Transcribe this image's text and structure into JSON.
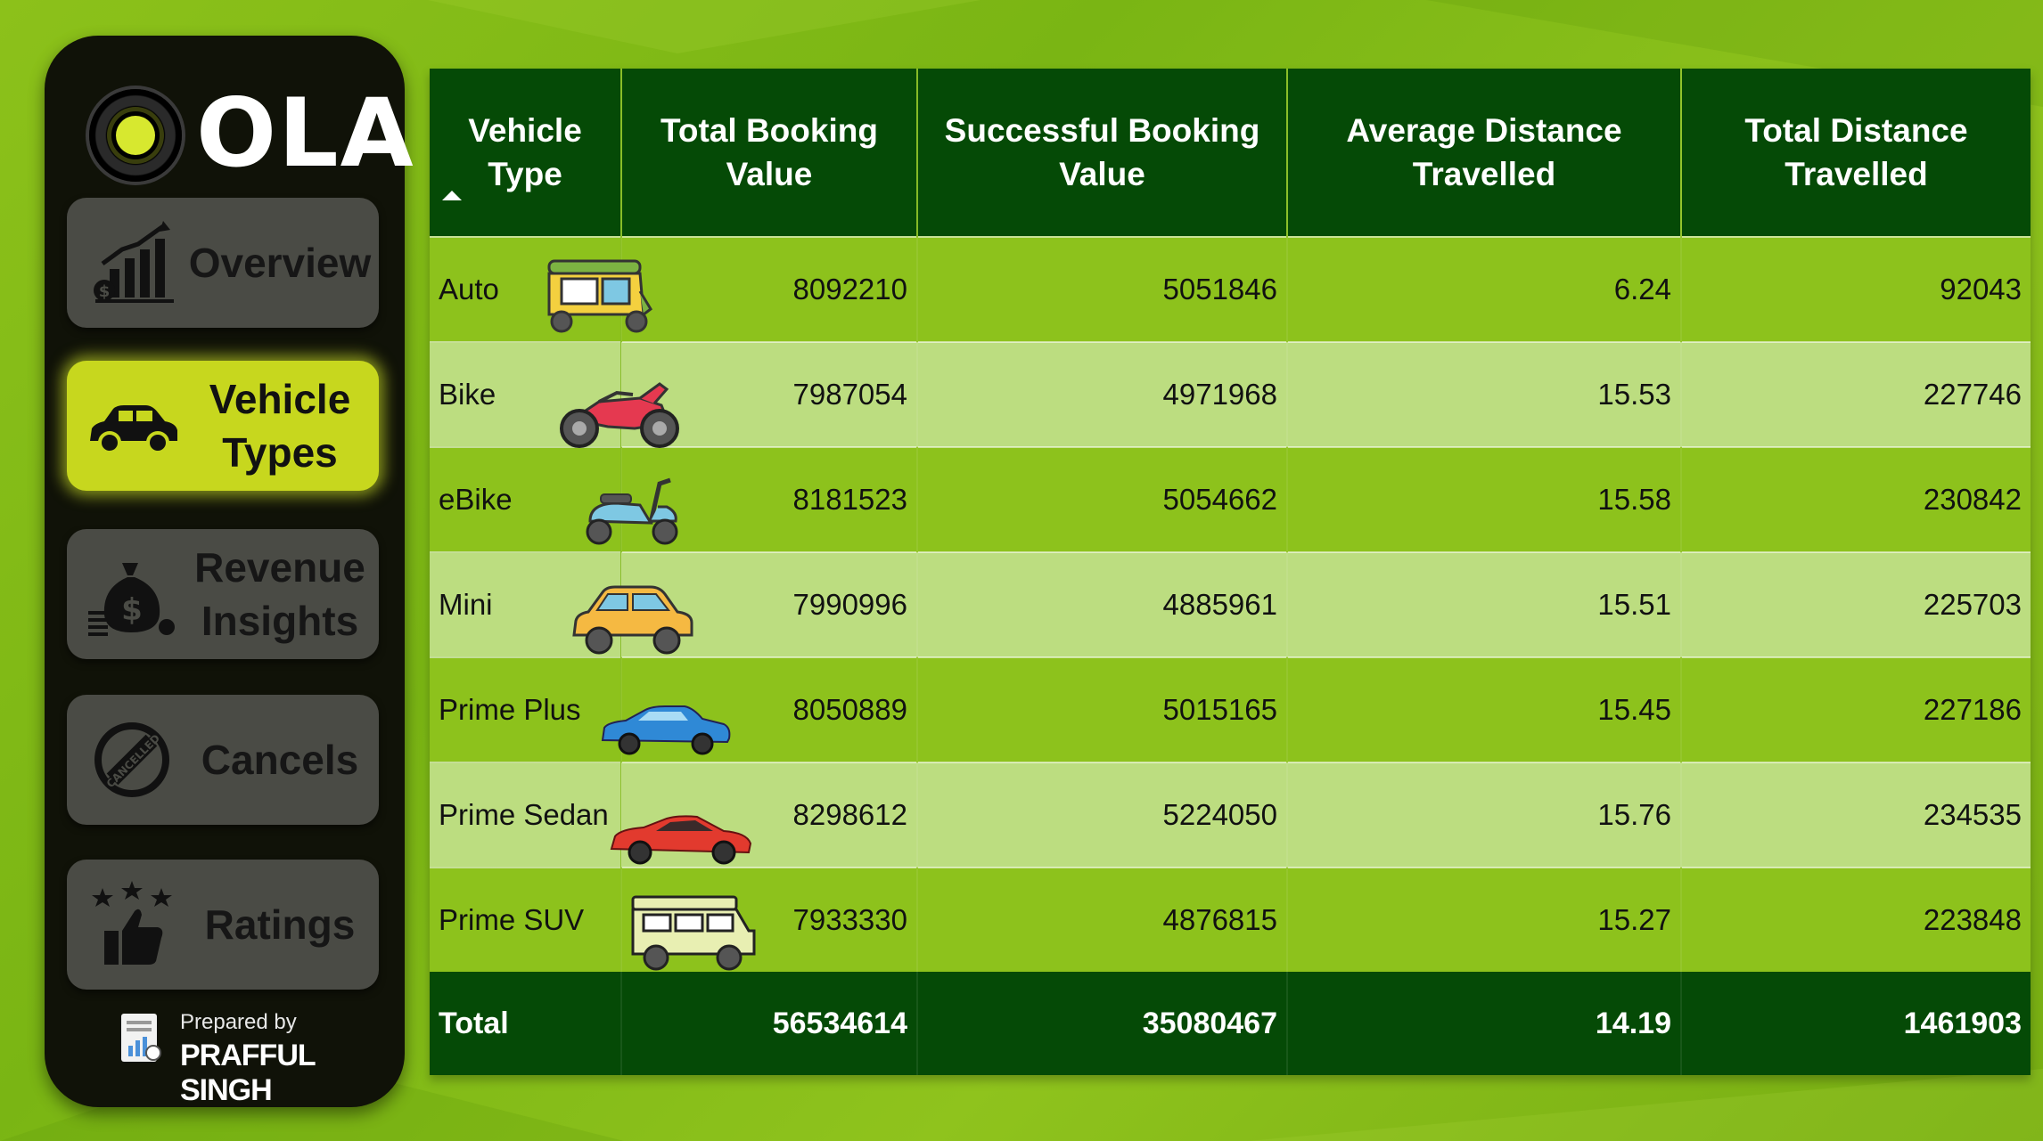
{
  "brand": {
    "logo_text": "OLA"
  },
  "nav": {
    "items": [
      {
        "label": "Overview",
        "icon": "bar-chart-dollar-icon",
        "active": false
      },
      {
        "label": "Vehicle\nTypes",
        "icon": "car-icon",
        "active": true
      },
      {
        "label": "Revenue\nInsights",
        "icon": "money-bag-icon",
        "active": false
      },
      {
        "label": "Cancels",
        "icon": "cancelled-stamp-icon",
        "active": false
      },
      {
        "label": "Ratings",
        "icon": "thumbs-up-stars-icon",
        "active": false
      }
    ]
  },
  "footer": {
    "prepared_by": "Prepared by",
    "author": "PRAFFUL SINGH"
  },
  "table": {
    "columns": [
      "Vehicle Type",
      "Total Booking Value",
      "Successful Booking Value",
      "Average Distance Travelled",
      "Total Distance Travelled"
    ],
    "rows": [
      {
        "type": "Auto",
        "icon": "auto-rickshaw-icon",
        "total": "8092210",
        "successful": "5051846",
        "avg": "6.24",
        "distance": "92043"
      },
      {
        "type": "Bike",
        "icon": "motorbike-icon",
        "total": "7987054",
        "successful": "4971968",
        "avg": "15.53",
        "distance": "227746"
      },
      {
        "type": "eBike",
        "icon": "scooter-icon",
        "total": "8181523",
        "successful": "5054662",
        "avg": "15.58",
        "distance": "230842"
      },
      {
        "type": "Mini",
        "icon": "mini-car-icon",
        "total": "7990996",
        "successful": "4885961",
        "avg": "15.51",
        "distance": "225703"
      },
      {
        "type": "Prime Plus",
        "icon": "blue-sedan-icon",
        "total": "8050889",
        "successful": "5015165",
        "avg": "15.45",
        "distance": "227186"
      },
      {
        "type": "Prime Sedan",
        "icon": "red-sports-car-icon",
        "total": "8298612",
        "successful": "5224050",
        "avg": "15.76",
        "distance": "234535"
      },
      {
        "type": "Prime SUV",
        "icon": "suv-jeep-icon",
        "total": "7933330",
        "successful": "4876815",
        "avg": "15.27",
        "distance": "223848"
      }
    ],
    "total": {
      "label": "Total",
      "total": "56534614",
      "successful": "35080467",
      "avg": "14.19",
      "distance": "1461903"
    }
  },
  "colors": {
    "background": "#8cc11a",
    "sidebar": "#101208",
    "header": "#054a06",
    "row_dark": "#8dc21c",
    "row_light": "#bcdd80",
    "active_nav": "#c7d71e"
  }
}
